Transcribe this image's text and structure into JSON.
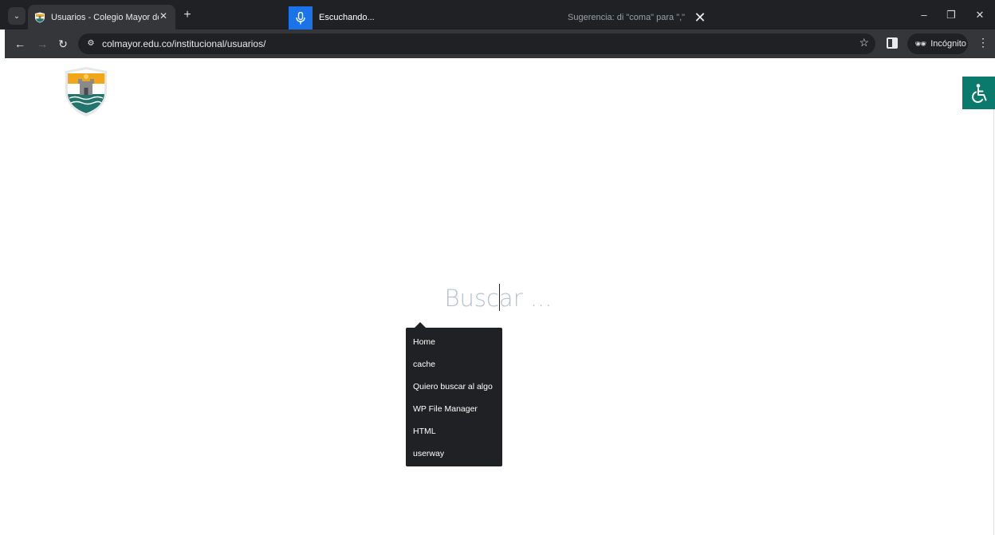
{
  "browser": {
    "tab": {
      "title": "Usuarios - Colegio Mayor de Ar"
    },
    "url": "colmayor.edu.co/institucional/usuarios/",
    "incognito_label": "Incógnito"
  },
  "voice": {
    "status": "Escuchando...",
    "hint": "Sugerencia: di \"coma\" para \",\""
  },
  "page": {
    "search": {
      "placeholder": "Buscar ..."
    },
    "suggestions": [
      "Home",
      "cache",
      "Quiero buscar al algo",
      "WP File Manager",
      "HTML",
      "userway"
    ]
  },
  "icons": {
    "tab_search": "chevron-down-icon",
    "close": "close-icon",
    "new_tab": "plus-icon",
    "mic": "microphone-icon",
    "back": "arrow-left-icon",
    "forward": "arrow-right-icon",
    "reload": "reload-icon",
    "site_info": "tune-icon",
    "bookmark": "star-icon",
    "side_panel": "side-panel-icon",
    "incognito": "incognito-icon",
    "menu": "more-vertical-icon",
    "accessibility": "wheelchair-icon"
  },
  "colors": {
    "chrome_dark": "#202124",
    "toolbar": "#35363a",
    "mic_blue": "#1a73e8",
    "voice_level_red": "#d1474a",
    "accessibility_teal": "#0a7a6c",
    "logo_gold": "#f2a71b",
    "logo_teal": "#21756d"
  }
}
